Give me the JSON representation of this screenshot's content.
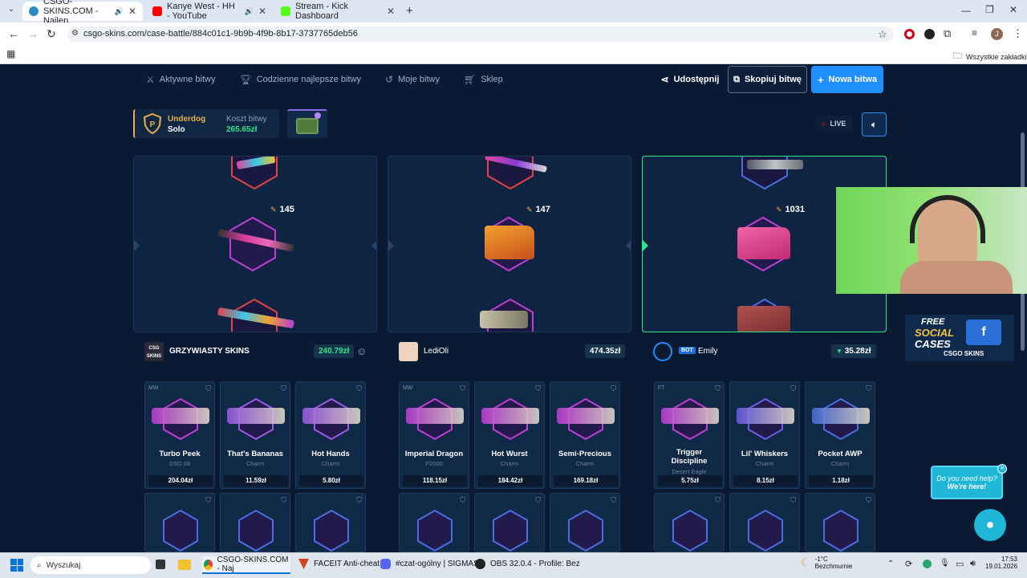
{
  "browser": {
    "tabs": [
      {
        "title": "CSGO-SKINS.COM - Najlep",
        "color": "#2e8bc0"
      },
      {
        "title": "Kanye West - HH - YouTube",
        "color": "#ff0000"
      },
      {
        "title": "Stream - Kick Dashboard",
        "color": "#53fc18"
      }
    ],
    "url": "csgo-skins.com/case-battle/884c01c1-9b9b-4f9b-8b17-3737765deb56",
    "bookmarks_label": "Wszystkie zakładki"
  },
  "nav": {
    "items": [
      "Aktywne bitwy",
      "Codzienne najlepsze bitwy",
      "Moje bitwy",
      "Sklep"
    ],
    "share": "Udostępnij",
    "copy": "Skopiuj bitwę",
    "new": "Nowa bitwa"
  },
  "battle": {
    "mode": "Underdog",
    "type": "Solo",
    "cost_label": "Koszt bitwy",
    "cost": "265.65zł",
    "live": "LIVE"
  },
  "spinners": [
    {
      "value": "145"
    },
    {
      "value": "147"
    },
    {
      "value": "1031"
    }
  ],
  "players": [
    {
      "name": "GRZYWIASTY SKINS",
      "total": "240.79zł",
      "items": [
        {
          "cond": "MW",
          "name": "Turbo Peek",
          "sub": "SSG 08",
          "price": "204.04zł",
          "color": "#c03cd6"
        },
        {
          "cond": "",
          "name": "That's Bananas",
          "sub": "Charm",
          "price": "11.59zł",
          "color": "#9b59e8"
        },
        {
          "cond": "",
          "name": "Hot Hands",
          "sub": "Charm",
          "price": "5.80zł",
          "color": "#9b59e8"
        }
      ]
    },
    {
      "name": "LediOli",
      "total": "474.35zł",
      "items": [
        {
          "cond": "MW",
          "name": "Imperial Dragon",
          "sub": "P2000",
          "price": "118.15zł",
          "color": "#c03cd6"
        },
        {
          "cond": "",
          "name": "Hot Wurst",
          "sub": "Charm",
          "price": "184.42zł",
          "color": "#c03cd6"
        },
        {
          "cond": "",
          "name": "Semi-Precious",
          "sub": "Charm",
          "price": "169.18zł",
          "color": "#c03cd6"
        }
      ]
    },
    {
      "name": "Emily",
      "bot": "BOT",
      "total": "35.28zł",
      "items": [
        {
          "cond": "FT",
          "name": "Trigger Discipline",
          "sub": "Desert Eagle",
          "price": "5.75zł",
          "color": "#c03cd6"
        },
        {
          "cond": "",
          "name": "Lil' Whiskers",
          "sub": "Charm",
          "price": "8.15zł",
          "color": "#6c5ce7"
        },
        {
          "cond": "",
          "name": "Pocket AWP",
          "sub": "Charm",
          "price": "1.18zł",
          "color": "#4a6ee0"
        }
      ]
    }
  ],
  "promo": {
    "line1": "FREE",
    "line2": "SOCIAL",
    "line3": "CASES",
    "brand": "CSGO SKINS"
  },
  "chat": {
    "line1": "Do you need help?",
    "line2": "We're here!"
  },
  "taskbar": {
    "search": "Wyszukaj",
    "apps": [
      "CSGO-SKINS.COM - Naj",
      "FACEIT Anti-cheat",
      "#czat-ogólny | SIGMAS",
      "OBS 32.0.4 - Profile: Bez"
    ],
    "weather_temp": "-1°C",
    "weather_desc": "Bezchmurnie",
    "time": "17:53",
    "date": "19.01.2026"
  }
}
